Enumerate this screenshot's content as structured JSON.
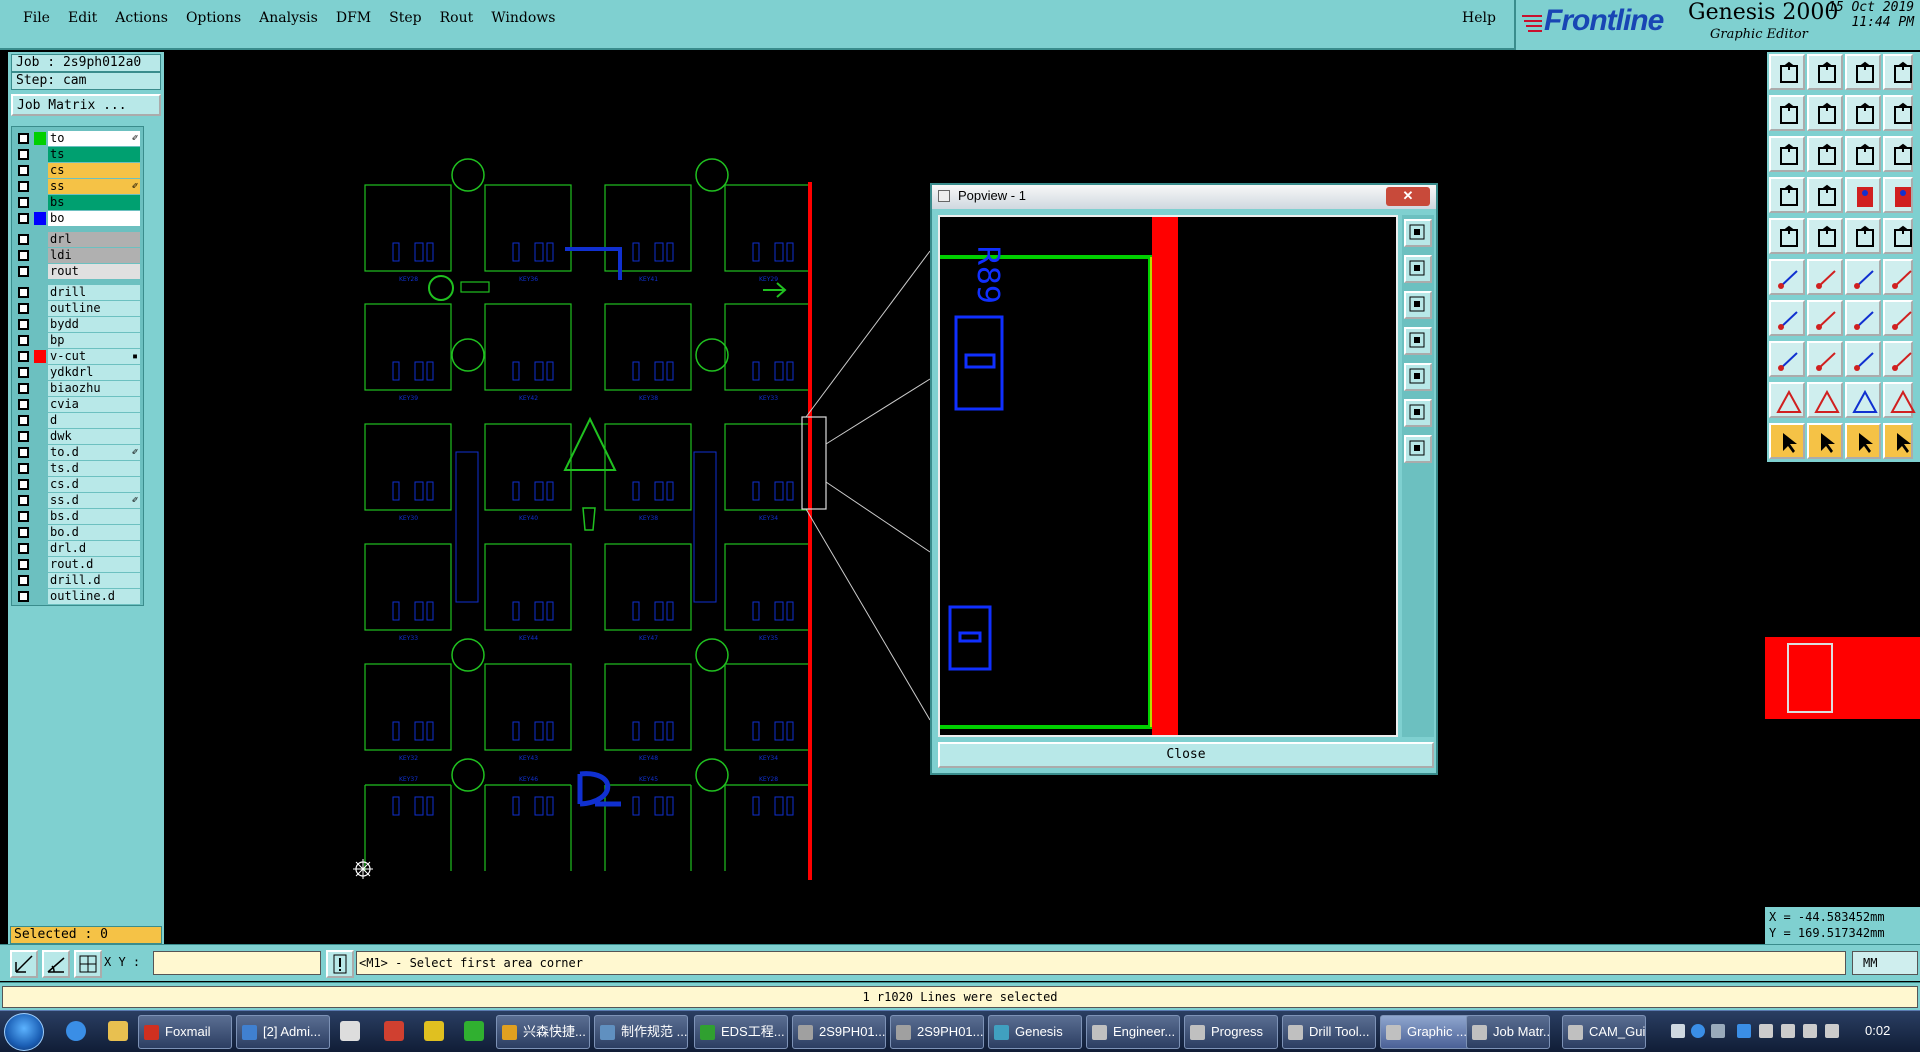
{
  "menubar": {
    "items": [
      "File",
      "Edit",
      "Actions",
      "Options",
      "Analysis",
      "DFM",
      "Step",
      "Rout",
      "Windows"
    ],
    "help": "Help"
  },
  "brand": {
    "logo": "Frontline",
    "product": "Genesis 2000",
    "subtitle": "Graphic Editor",
    "date": "15 Oct 2019",
    "time": "11:44 PM"
  },
  "job": {
    "job_label": "Job : 2s9ph012a0",
    "step_label": "Step: cam",
    "matrix_button": "Job Matrix ..."
  },
  "layers": [
    {
      "name": "to",
      "swatch": "#00d000",
      "bg": "#ffffff",
      "mark": "✐"
    },
    {
      "name": "ts",
      "swatch": "",
      "bg": "#00a070",
      "mark": ""
    },
    {
      "name": "cs",
      "swatch": "",
      "bg": "#f5c246",
      "mark": ""
    },
    {
      "name": "ss",
      "swatch": "",
      "bg": "#f5c246",
      "mark": "✐"
    },
    {
      "name": "bs",
      "swatch": "",
      "bg": "#00a070",
      "mark": ""
    },
    {
      "name": "bo",
      "swatch": "#0000ff",
      "bg": "#ffffff",
      "mark": ""
    },
    {
      "name": "drl",
      "swatch": "",
      "bg": "#b0b0b0",
      "mark": ""
    },
    {
      "name": "ldi",
      "swatch": "",
      "bg": "#b0b0b0",
      "mark": ""
    },
    {
      "name": "rout",
      "swatch": "",
      "bg": "#e0e0e0",
      "mark": ""
    },
    {
      "name": "drill",
      "swatch": "",
      "bg": "#b8e8e8",
      "mark": ""
    },
    {
      "name": "outline",
      "swatch": "",
      "bg": "#b8e8e8",
      "mark": ""
    },
    {
      "name": "bydd",
      "swatch": "",
      "bg": "#b8e8e8",
      "mark": ""
    },
    {
      "name": "bp",
      "swatch": "",
      "bg": "#b8e8e8",
      "mark": ""
    },
    {
      "name": "v-cut",
      "swatch": "#ff0000",
      "bg": "#b8e8e8",
      "mark": "▪"
    },
    {
      "name": "ydkdrl",
      "swatch": "",
      "bg": "#b8e8e8",
      "mark": ""
    },
    {
      "name": "biaozhu",
      "swatch": "",
      "bg": "#b8e8e8",
      "mark": ""
    },
    {
      "name": "cvia",
      "swatch": "",
      "bg": "#b8e8e8",
      "mark": ""
    },
    {
      "name": "d",
      "swatch": "",
      "bg": "#b8e8e8",
      "mark": ""
    },
    {
      "name": "dwk",
      "swatch": "",
      "bg": "#b8e8e8",
      "mark": ""
    },
    {
      "name": "to.d",
      "swatch": "",
      "bg": "#b8e8e8",
      "mark": "✐"
    },
    {
      "name": "ts.d",
      "swatch": "",
      "bg": "#b8e8e8",
      "mark": ""
    },
    {
      "name": "cs.d",
      "swatch": "",
      "bg": "#b8e8e8",
      "mark": ""
    },
    {
      "name": "ss.d",
      "swatch": "",
      "bg": "#b8e8e8",
      "mark": "✐"
    },
    {
      "name": "bs.d",
      "swatch": "",
      "bg": "#b8e8e8",
      "mark": ""
    },
    {
      "name": "bo.d",
      "swatch": "",
      "bg": "#b8e8e8",
      "mark": ""
    },
    {
      "name": "drl.d",
      "swatch": "",
      "bg": "#b8e8e8",
      "mark": ""
    },
    {
      "name": "rout.d",
      "swatch": "",
      "bg": "#b8e8e8",
      "mark": ""
    },
    {
      "name": "drill.d",
      "swatch": "",
      "bg": "#b8e8e8",
      "mark": ""
    },
    {
      "name": "outline.d",
      "swatch": "",
      "bg": "#b8e8e8",
      "mark": ""
    }
  ],
  "selected": "Selected : 0",
  "popview": {
    "title": "Popview - 1",
    "close": "Close",
    "close_x": "✕"
  },
  "pcb": {
    "labels": [
      "KEY28",
      "KEY36",
      "KEY41",
      "KEY29",
      "KEY39",
      "KEY42",
      "KEY38",
      "KEY33",
      "KEY30",
      "KEY40",
      "KEY38",
      "KEY34",
      "KEY33",
      "KEY44",
      "KEY47",
      "KEY35",
      "KEY32",
      "KEY43",
      "KEY48",
      "KEY34",
      "KEY37",
      "KEY46",
      "KEY45"
    ]
  },
  "coords": {
    "x": "X = -44.583452mm",
    "y": "Y = 169.517342mm"
  },
  "command": {
    "xy_label": "X Y :",
    "input_value": "",
    "prompt": "<M1> - Select first area corner",
    "units": "MM"
  },
  "status": "1 r1020 Lines were selected",
  "taskbar": {
    "items": [
      {
        "label": "Foxmail",
        "color": "#d03020"
      },
      {
        "label": "[2] Admi...",
        "color": "#4080d0"
      },
      {
        "label": "兴森快捷...",
        "color": "#e0a020"
      },
      {
        "label": "制作规范 ...",
        "color": "#6090c0"
      },
      {
        "label": "EDS工程...",
        "color": "#30a030"
      },
      {
        "label": "2S9PH01...",
        "color": "#a0a0a0"
      },
      {
        "label": "2S9PH01...",
        "color": "#a0a0a0"
      },
      {
        "label": "Genesis",
        "color": "#40a0c0"
      },
      {
        "label": "Engineer...",
        "color": "#c0c0c0"
      },
      {
        "label": "Progress",
        "color": "#c0c0c0"
      },
      {
        "label": "Drill Tool...",
        "color": "#c0c0c0"
      },
      {
        "label": "Graphic ...",
        "color": "#c0c0c0"
      },
      {
        "label": "Job Matr...",
        "color": "#c0c0c0"
      },
      {
        "label": "CAM_Gui...",
        "color": "#c0c0c0"
      }
    ],
    "clock": "0:02"
  }
}
